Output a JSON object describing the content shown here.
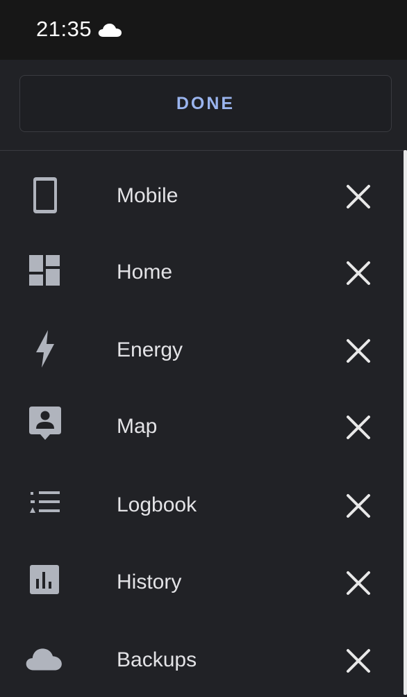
{
  "status_bar": {
    "time": "21:35",
    "weather_icon": "cloud-icon"
  },
  "header": {
    "done_label": "DONE"
  },
  "colors": {
    "accent": "#9ab4ee",
    "background": "#212226",
    "text": "#e3e3e6",
    "icon": "#b0b4bd"
  },
  "items": [
    {
      "label": "Mobile",
      "icon": "mobile-phone-icon"
    },
    {
      "label": "Home",
      "icon": "dashboard-icon"
    },
    {
      "label": "Energy",
      "icon": "lightning-bolt-icon"
    },
    {
      "label": "Map",
      "icon": "map-account-icon"
    },
    {
      "label": "Logbook",
      "icon": "list-icon"
    },
    {
      "label": "History",
      "icon": "chart-box-icon"
    },
    {
      "label": "Backups",
      "icon": "cloud-icon"
    }
  ]
}
